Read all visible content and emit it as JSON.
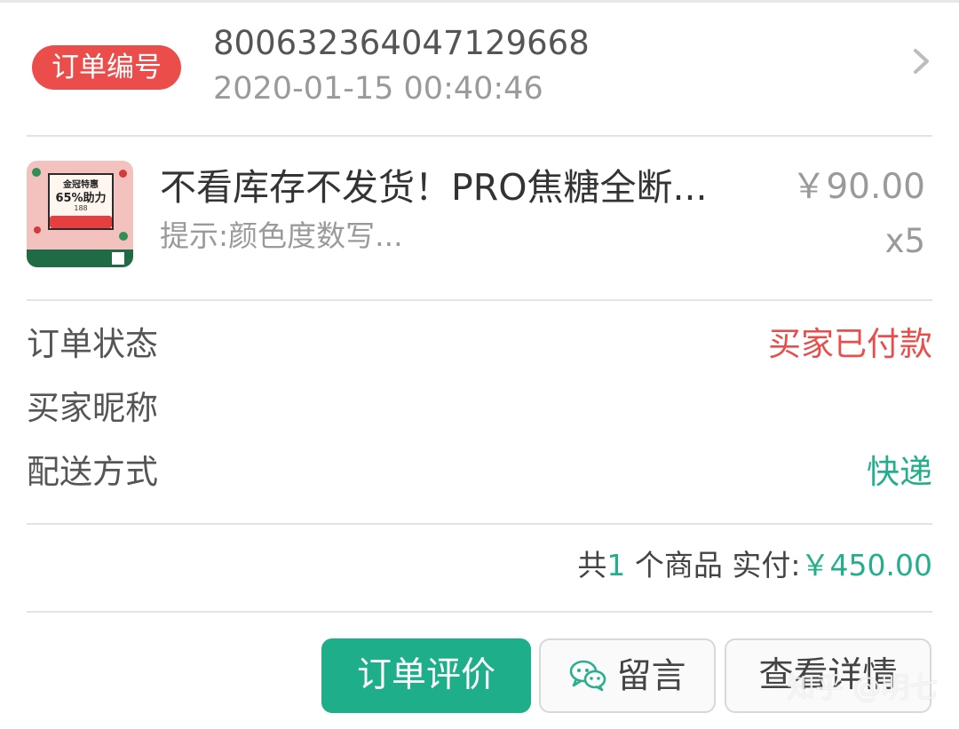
{
  "order": {
    "badge_label": "订单编号",
    "number": "800632364047129668",
    "time": "2020-01-15 00:40:46"
  },
  "product": {
    "thumbnail": {
      "line1": "金冠特惠",
      "line2": "65%助力",
      "line3": "188"
    },
    "title": "不看库存不发货！PRO焦糖全断...",
    "tip": "提示:颜色度数写...",
    "price": "￥90.00",
    "quantity": "x5"
  },
  "info": {
    "status_label": "订单状态",
    "status_value": "买家已付款",
    "nickname_label": "买家昵称",
    "nickname_value": "",
    "delivery_label": "配送方式",
    "delivery_value": "快递"
  },
  "summary": {
    "prefix": "共",
    "count": "1",
    "middle": " 个商品 实付:",
    "total": "￥450.00"
  },
  "actions": {
    "review_label": "订单评价",
    "message_label": "留言",
    "detail_label": "查看详情"
  },
  "watermark": "知乎 @明七",
  "colors": {
    "badge": "#eb4d4b",
    "status_red": "#e84e4b",
    "accent_green": "#24ae8c",
    "review_button": "#1fae8a"
  },
  "icons": {
    "chevron": "chevron-right-icon",
    "wechat": "wechat-icon"
  }
}
